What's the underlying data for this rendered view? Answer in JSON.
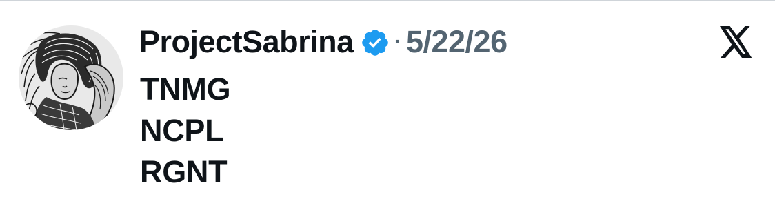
{
  "author": {
    "display_name": "ProjectSabrina",
    "verified": true,
    "avatar_icon": "sketch-portrait-avatar"
  },
  "meta": {
    "separator": "·",
    "date": "5/22/26"
  },
  "platform": {
    "logo_icon": "x-logo-icon"
  },
  "tweet": {
    "lines": [
      "TNMG",
      "NCPL",
      "RGNT"
    ]
  },
  "colors": {
    "text_primary": "#0f1419",
    "text_secondary": "#536471",
    "verified_blue": "#1d9bf0"
  }
}
